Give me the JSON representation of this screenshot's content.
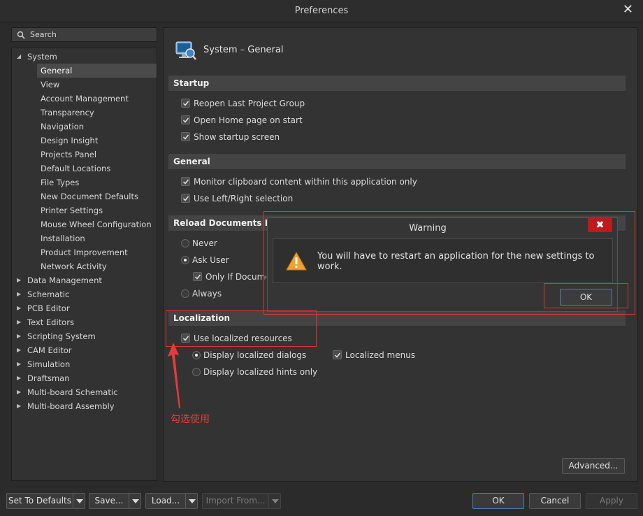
{
  "window": {
    "title": "Preferences"
  },
  "search": {
    "placeholder": "Search"
  },
  "tree": {
    "system": "System",
    "system_children": [
      "General",
      "View",
      "Account Management",
      "Transparency",
      "Navigation",
      "Design Insight",
      "Projects Panel",
      "Default Locations",
      "File Types",
      "New Document Defaults",
      "Printer Settings",
      "Mouse Wheel Configuration",
      "Installation",
      "Product Improvement",
      "Network Activity"
    ],
    "other_groups": [
      "Data Management",
      "Schematic",
      "PCB Editor",
      "Text Editors",
      "Scripting System",
      "CAM Editor",
      "Simulation",
      "Draftsman",
      "Multi-board Schematic",
      "Multi-board Assembly"
    ]
  },
  "page": {
    "title": "System – General"
  },
  "startup": {
    "header": "Startup",
    "options": [
      "Reopen Last Project Group",
      "Open Home page on start",
      "Show startup screen"
    ]
  },
  "general": {
    "header": "General",
    "options": [
      "Monitor clipboard content within this application only",
      "Use Left/Right selection"
    ]
  },
  "reload": {
    "header": "Reload Documents Modif",
    "never": "Never",
    "ask": "Ask User",
    "only_if": "Only If Document",
    "always": "Always"
  },
  "localization": {
    "header": "Localization",
    "use_localized": "Use localized resources",
    "display_dialogs": "Display localized dialogs",
    "display_hints": "Display localized hints only",
    "localized_menus": "Localized menus"
  },
  "buttons": {
    "advanced": "Advanced...",
    "set_defaults": "Set To Defaults",
    "save": "Save...",
    "load": "Load...",
    "import_from": "Import From...",
    "ok": "OK",
    "cancel": "Cancel",
    "apply": "Apply"
  },
  "warning": {
    "title": "Warning",
    "message": "You will have to restart an application for the new settings to work.",
    "ok": "OK"
  },
  "annotation": {
    "text": "勾选使用",
    "color": "#e83a3a"
  },
  "icons": [
    "search-icon",
    "system-general-icon",
    "warning-icon",
    "close-icon",
    "checkmark-icon",
    "arrow-icon"
  ]
}
